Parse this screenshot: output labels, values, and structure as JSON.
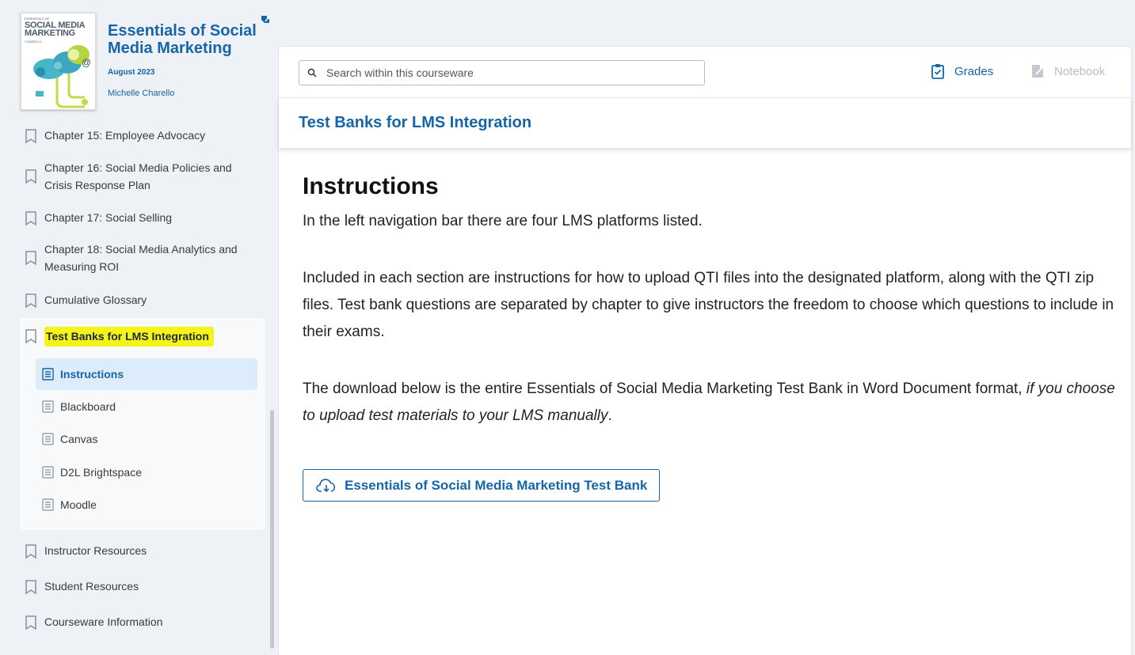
{
  "book": {
    "cover_top": "ESSENTIALS OF",
    "cover_title_1": "SOCIAL MEDIA",
    "cover_title_2": "MARKETING",
    "cover_author": "CHARELLO",
    "title": "Essentials of Social Media Marketing",
    "date": "August 2023",
    "author": "Michelle Charello"
  },
  "sidebar": {
    "items_before": [
      {
        "label": "Chapter 15: Employee Advocacy"
      },
      {
        "label": "Chapter 16: Social Media Policies and Crisis Response Plan"
      },
      {
        "label": "Chapter 17: Social Selling"
      },
      {
        "label": "Chapter 18: Social Media Analytics and Measuring ROI"
      },
      {
        "label": "Cumulative Glossary"
      }
    ],
    "group": {
      "label": "Test Banks for LMS Integration",
      "children": [
        {
          "label": "Instructions",
          "active": true
        },
        {
          "label": "Blackboard"
        },
        {
          "label": "Canvas"
        },
        {
          "label": "D2L Brightspace"
        },
        {
          "label": "Moodle"
        }
      ]
    },
    "items_after": [
      {
        "label": "Instructor Resources"
      },
      {
        "label": "Student Resources"
      },
      {
        "label": "Courseware Information"
      }
    ]
  },
  "toolbar": {
    "search_placeholder": "Search within this courseware",
    "grades_label": "Grades",
    "notebook_label": "Notebook"
  },
  "section": {
    "title": "Test Banks for LMS Integration"
  },
  "content": {
    "heading": "Instructions",
    "para1": "In the left navigation bar there are four LMS platforms listed.",
    "para2": "Included in each section are instructions for how to upload QTI files into the designated platform, along with the QTI zip files. Test bank questions are separated by chapter to give instructors the freedom to choose which questions to include in their exams.",
    "para3_main": "The download below is the entire Essentials of Social Media Marketing Test Bank in Word Document format, ",
    "para3_italic": "if you choose to upload test materials to your LMS manually",
    "para3_end": ".",
    "download_label": "Essentials of Social Media Marketing Test Bank"
  },
  "colors": {
    "accent": "#1565a8",
    "highlight": "#f4f41a",
    "active_bg": "#dcecfa",
    "page_bg": "#eef1f5"
  }
}
